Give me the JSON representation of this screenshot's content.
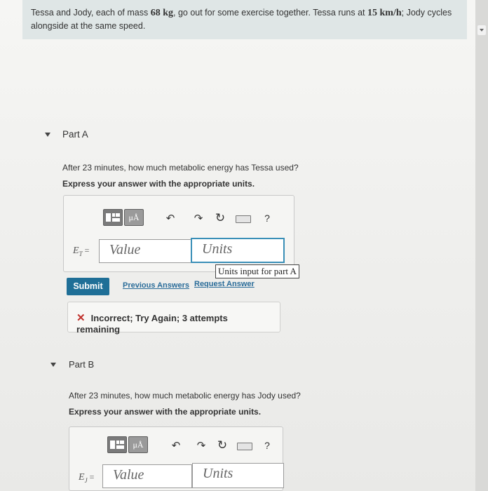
{
  "problem": {
    "text_a": "Tessa and Jody, each of mass ",
    "mass": "68 kg",
    "text_b": ", go out for some exercise together. Tessa runs at ",
    "speed": "15 km/h",
    "text_c": "; Jody cycles alongside at the same speed."
  },
  "part_a": {
    "label": "Part A",
    "question": "After 23 minutes, how much metabolic energy has Tessa used?",
    "instruction": "Express your answer with the appropriate units.",
    "var_main": "E",
    "var_sub": "T",
    "equals": " =",
    "value_placeholder": "Value",
    "units_placeholder": "Units",
    "tooltip": "Units input for part A",
    "submit_label": "Submit",
    "previous_answers": "Previous Answers",
    "request_answer": "Request Answer",
    "feedback": "Incorrect; Try Again; 3 attempts remaining"
  },
  "part_b": {
    "label": "Part B",
    "question": "After 23 minutes, how much metabolic energy has Jody used?",
    "instruction": "Express your answer with the appropriate units.",
    "var_main": "E",
    "var_sub": "J",
    "equals": " =",
    "value_placeholder": "Value",
    "units_placeholder": "Units"
  },
  "toolbar": {
    "mu_label": "μÅ",
    "help_label": "?",
    "undo_glyph": "↶",
    "redo_glyph": "↷",
    "reset_glyph": "↻"
  },
  "icons": [
    "templates-icon",
    "symbols-icon",
    "undo-icon",
    "redo-icon",
    "reset-icon",
    "keyboard-icon",
    "help-icon",
    "incorrect-icon"
  ]
}
